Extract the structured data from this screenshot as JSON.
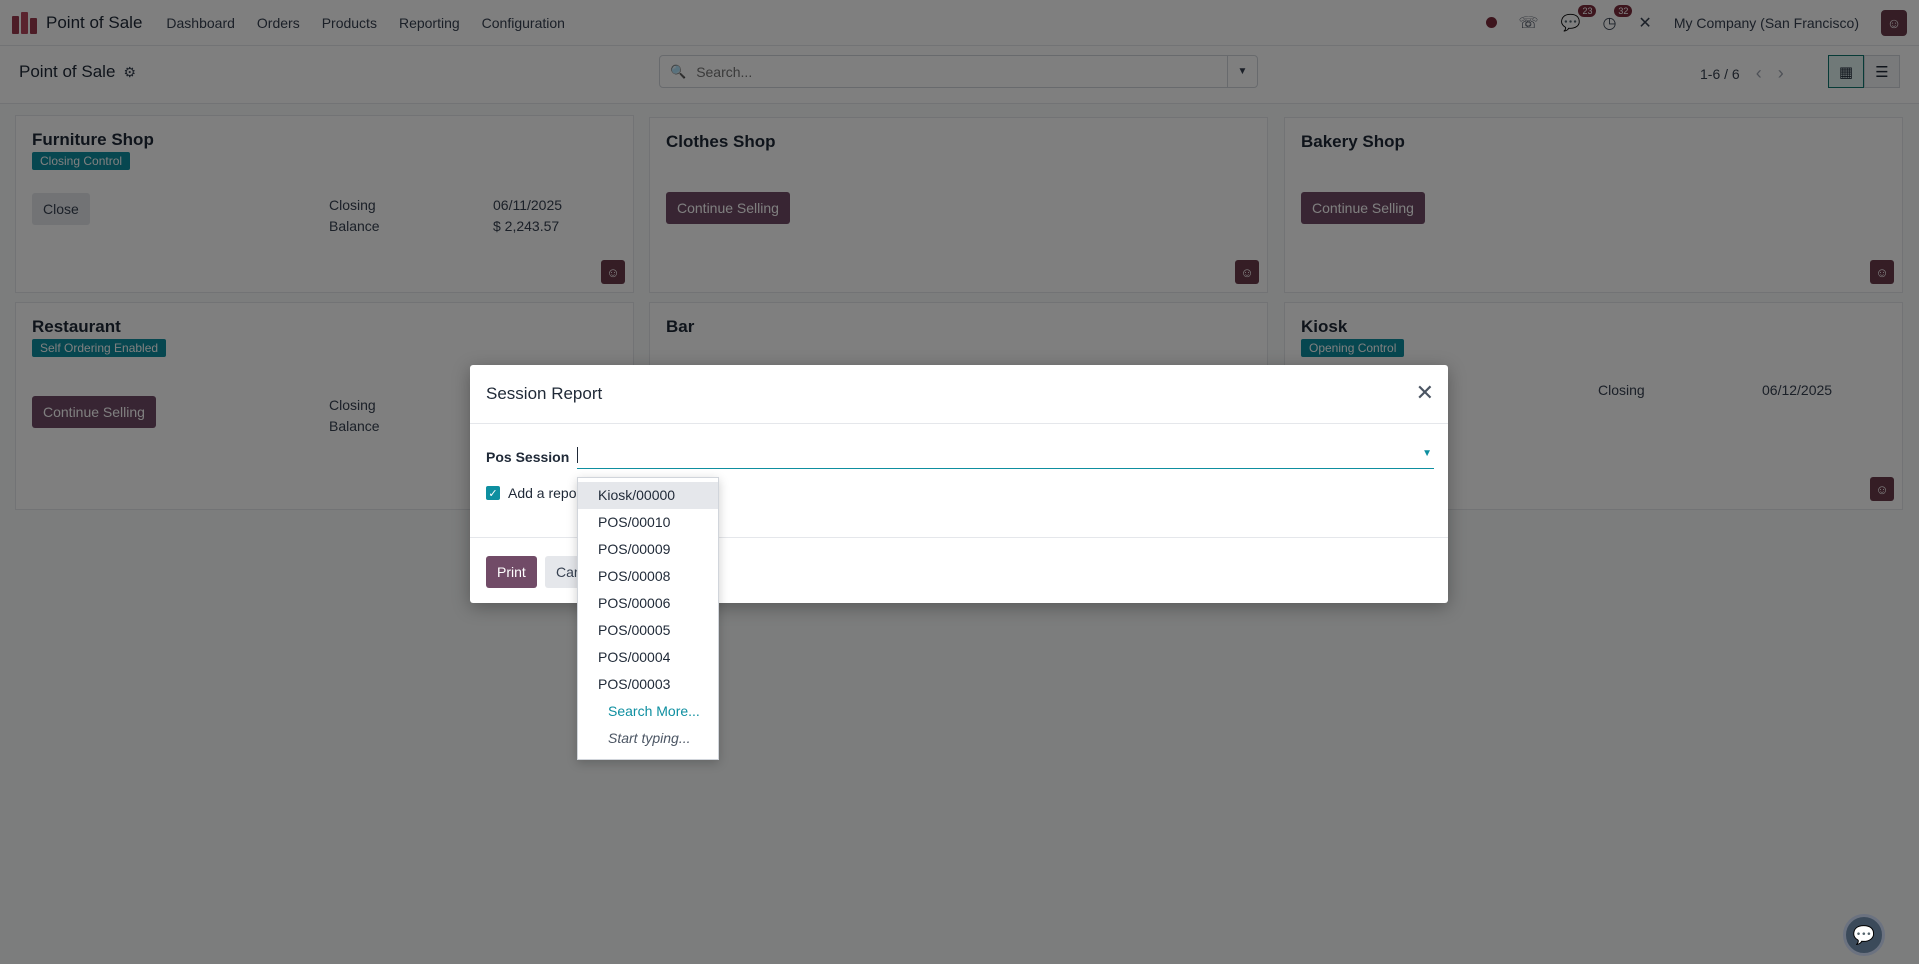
{
  "app": {
    "title": "Point of Sale",
    "menu": [
      "Dashboard",
      "Orders",
      "Products",
      "Reporting",
      "Configuration"
    ],
    "chat_count": "23",
    "activity_count": "32",
    "company": "My Company (San Francisco)"
  },
  "control": {
    "breadcrumb": "Point of Sale",
    "search_placeholder": "Search...",
    "pager": "1-6 / 6"
  },
  "cards": [
    {
      "title": "Furniture Shop",
      "tag": "Closing Control",
      "button": "Close",
      "label1": "Closing",
      "value1": "06/11/2025",
      "label2": "Balance",
      "value2": "$ 2,243.57"
    },
    {
      "title": "Clothes Shop",
      "button": "Continue Selling"
    },
    {
      "title": "Bakery Shop",
      "button": "Continue Selling"
    },
    {
      "title": "Restaurant",
      "tag": "Self Ordering Enabled",
      "button": "Continue Selling",
      "label1": "Closing",
      "label2": "Balance"
    },
    {
      "title": "Bar"
    },
    {
      "title": "Kiosk",
      "tag": "Opening Control",
      "label1": "Closing",
      "value1": "06/12/2025"
    }
  ],
  "modal": {
    "title": "Session Report",
    "field_label": "Pos Session",
    "checkbox_label": "Add a repo",
    "print_label": "Print",
    "cancel_label": "Car"
  },
  "dropdown": {
    "items": [
      "Kiosk/00000",
      "POS/00010",
      "POS/00009",
      "POS/00008",
      "POS/00006",
      "POS/00005",
      "POS/00004",
      "POS/00003"
    ],
    "search_more": "Search More...",
    "hint": "Start typing..."
  }
}
